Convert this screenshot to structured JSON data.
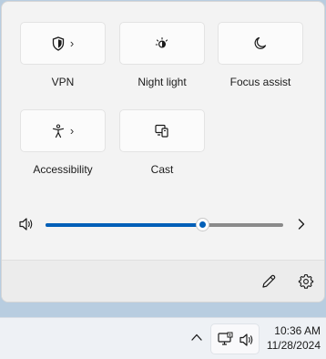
{
  "quick_settings": {
    "tiles": [
      {
        "label": "VPN",
        "icon": "shield-icon",
        "has_chevron": true
      },
      {
        "label": "Night light",
        "icon": "night-light-icon",
        "has_chevron": false
      },
      {
        "label": "Focus assist",
        "icon": "moon-icon",
        "has_chevron": false
      },
      {
        "label": "Accessibility",
        "icon": "accessibility-icon",
        "has_chevron": true
      },
      {
        "label": "Cast",
        "icon": "cast-icon",
        "has_chevron": false
      }
    ],
    "chevron_glyph": "›"
  },
  "volume": {
    "level_fraction": 0.66,
    "accent_color": "#005fb8",
    "icon": "speaker-icon"
  },
  "footer": {
    "edit_icon": "pencil-icon",
    "settings_icon": "gear-icon"
  },
  "taskbar": {
    "time": "10:36 AM",
    "date": "11/28/2024",
    "overflow_icon": "chevron-up-icon",
    "network_icon": "network-icon",
    "volume_icon": "speaker-icon"
  }
}
